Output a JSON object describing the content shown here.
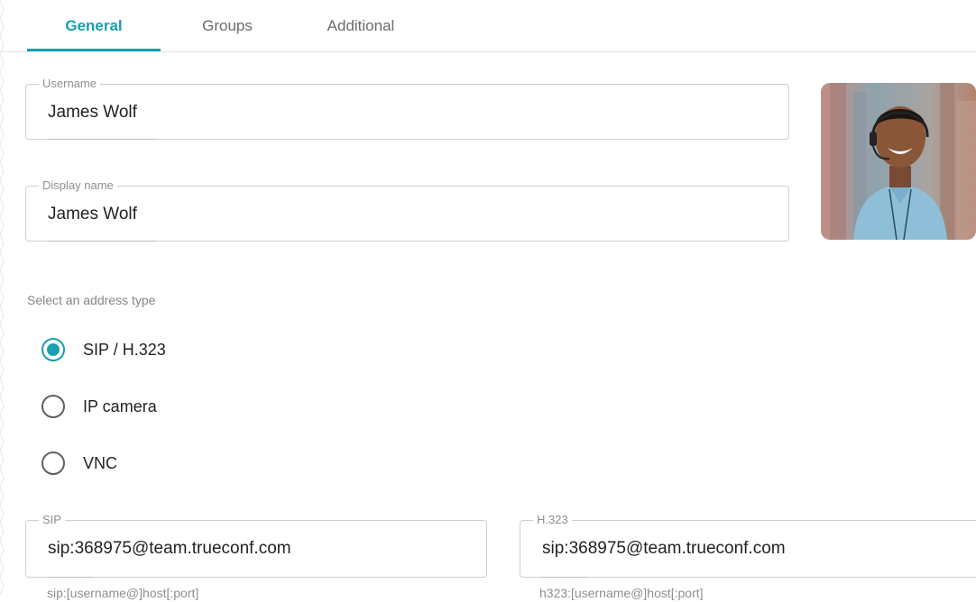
{
  "tabs": [
    {
      "label": "General",
      "active": true
    },
    {
      "label": "Groups",
      "active": false
    },
    {
      "label": "Additional",
      "active": false
    }
  ],
  "username": {
    "label": "Username",
    "value": "James Wolf"
  },
  "display_name": {
    "label": "Display name",
    "value": "James Wolf"
  },
  "address_type": {
    "label": "Select an address type",
    "options": [
      {
        "label": "SIP / H.323",
        "checked": true
      },
      {
        "label": "IP camera",
        "checked": false
      },
      {
        "label": "VNC",
        "checked": false
      }
    ]
  },
  "sip": {
    "label": "SIP",
    "value": "sip:368975@team.trueconf.com",
    "hint": "sip:[username@]host[:port]"
  },
  "h323": {
    "label": "H.323",
    "value": "sip:368975@team.trueconf.com",
    "hint": "h323:[username@]host[:port]"
  },
  "colors": {
    "accent": "#1a9eb0",
    "border": "#cfcfcf",
    "label": "#8e8e8e"
  },
  "avatar": {
    "icon": "user-photo"
  }
}
